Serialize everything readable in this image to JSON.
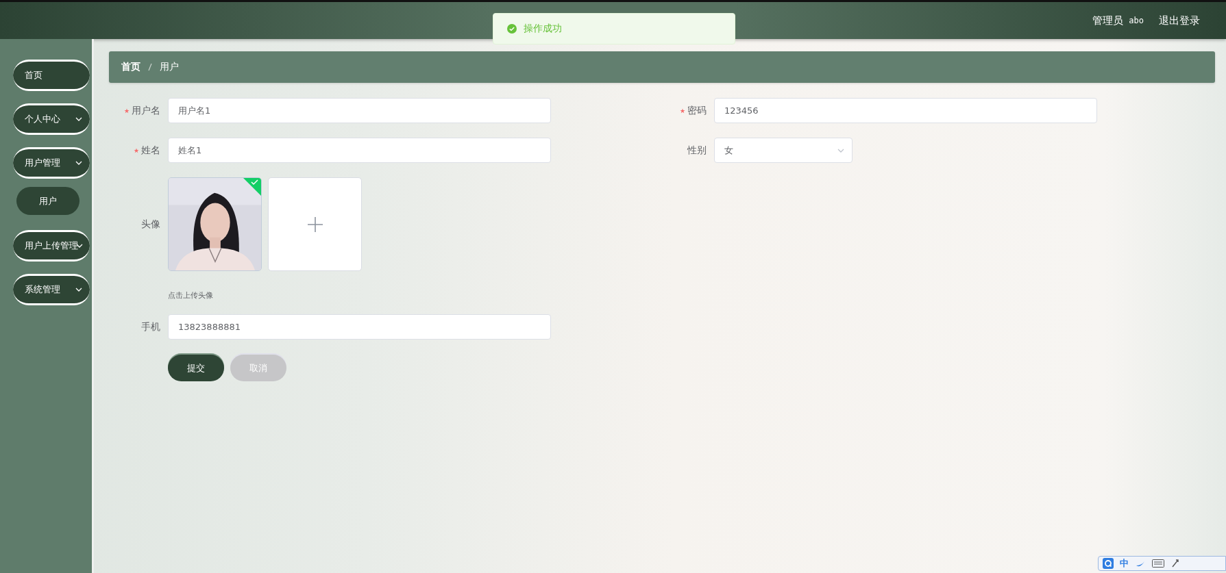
{
  "header": {
    "user_role": "管理员",
    "username": "abo",
    "logout": "退出登录"
  },
  "toast": {
    "kind": "success",
    "message": "操作成功"
  },
  "sidebar": {
    "items": [
      {
        "label": "首页",
        "kind": "link"
      },
      {
        "label": "个人中心",
        "kind": "submenu"
      },
      {
        "label": "用户管理",
        "kind": "submenu",
        "children": [
          {
            "label": "用户"
          }
        ]
      },
      {
        "label": "用户上传管理",
        "kind": "submenu"
      },
      {
        "label": "系统管理",
        "kind": "submenu"
      }
    ]
  },
  "breadcrumb": [
    {
      "label": "首页",
      "bold": true
    },
    {
      "label": "用户",
      "bold": false
    }
  ],
  "form": {
    "rows": [
      [
        {
          "kind": "text",
          "label": "用户名",
          "required": true,
          "value": "用户名1"
        },
        {
          "kind": "text",
          "label": "密码",
          "required": true,
          "value": "123456"
        }
      ],
      [
        {
          "kind": "text",
          "label": "姓名",
          "required": true,
          "value": "姓名1"
        },
        {
          "kind": "select",
          "label": "性别",
          "required": false,
          "value": "女"
        }
      ],
      [
        {
          "kind": "upload",
          "label": "头像",
          "required": false,
          "uploaded": true,
          "hint": "点击上传头像"
        }
      ],
      [
        {
          "kind": "text",
          "label": "手机",
          "required": false,
          "value": "13823888881"
        }
      ]
    ],
    "buttons": [
      {
        "label": "提交",
        "kind": "primary"
      },
      {
        "label": "取消",
        "kind": "secondary"
      }
    ]
  },
  "ime_bar": {
    "mode": "中"
  }
}
